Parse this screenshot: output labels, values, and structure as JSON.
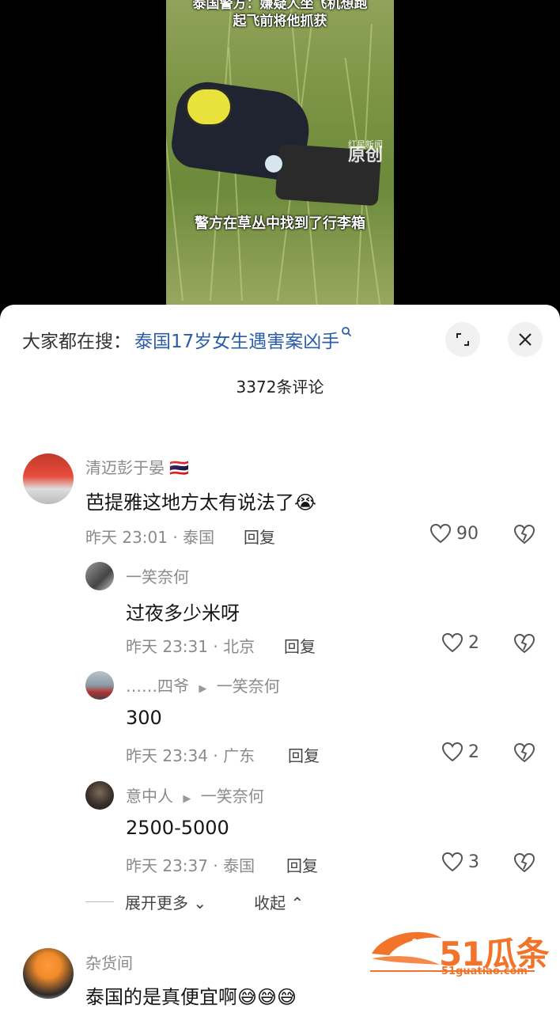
{
  "video": {
    "title_line1": "泰国警方：嫌疑人坐飞机想跑",
    "title_line2": "起飞前将他抓获",
    "caption": "警方在草丛中找到了行李箱",
    "watermark_small": "红星新闻",
    "watermark_big": "原创"
  },
  "sheet": {
    "search_prefix": "大家都在搜：",
    "search_term": "泰国17岁女生遇害案凶手",
    "comment_count": "3372条评论"
  },
  "comments": [
    {
      "nick": "清迈彭于晏",
      "nick_badge": "🇹🇭",
      "text": "芭提雅这地方太有说法了",
      "emoji": "😭",
      "meta": "昨天 23:01 · 泰国",
      "reply_label": "回复",
      "likes": "90"
    },
    {
      "nick": "一笑奈何",
      "text": "过夜多少米呀",
      "meta": "昨天 23:31 · 北京",
      "reply_label": "回复",
      "likes": "2"
    },
    {
      "nick": "……四爷",
      "reply_to": "一笑奈何",
      "text": "300",
      "meta": "昨天 23:34 · 广东",
      "reply_label": "回复",
      "likes": "2"
    },
    {
      "nick": "意中人",
      "reply_to": "一笑奈何",
      "text": "2500-5000",
      "meta": "昨天 23:37 · 泰国",
      "reply_label": "回复",
      "likes": "3"
    },
    {
      "nick": "杂货间",
      "text": "泰国的是真便宜啊",
      "emoji": "😅😅😅"
    }
  ],
  "thread_controls": {
    "expand_more": "展开更多",
    "collapse": "收起"
  },
  "logo": {
    "text": "51瓜条",
    "sub": "51guatiao.com"
  },
  "icons": {
    "search": "search-icon",
    "expand": "expand-icon",
    "close": "close-icon",
    "like": "heart-icon",
    "dislike": "broken-heart-icon"
  },
  "colors": {
    "link": "#2b5ca8",
    "meta": "#8a8a8a",
    "logo": "#f2742a"
  }
}
